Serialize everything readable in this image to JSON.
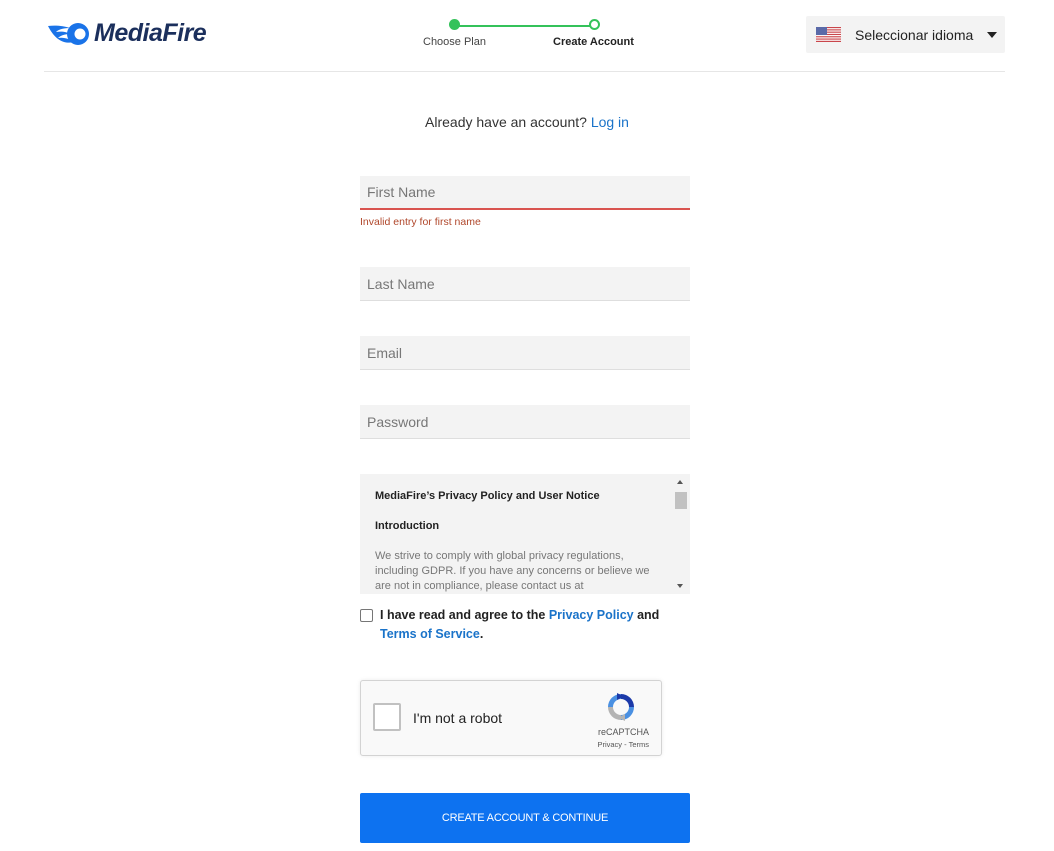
{
  "header": {
    "logo_text": "MediaFire",
    "steps": [
      {
        "label": "Choose Plan",
        "status": "complete"
      },
      {
        "label": "Create Account",
        "status": "current"
      }
    ],
    "language_selector": {
      "label": "Seleccionar idioma",
      "flag_icon": "us-flag-icon"
    }
  },
  "login_prompt": {
    "text": "Already have an account?",
    "link_label": "Log in"
  },
  "form": {
    "first_name": {
      "placeholder": "First Name",
      "value": "",
      "error": "Invalid entry for first name"
    },
    "last_name": {
      "placeholder": "Last Name",
      "value": ""
    },
    "email": {
      "placeholder": "Email",
      "value": ""
    },
    "password": {
      "placeholder": "Password",
      "value": ""
    }
  },
  "policy": {
    "title": "MediaFire’s Privacy Policy and User Notice",
    "section": "Introduction",
    "body": "We strive to comply with global privacy regulations, including GDPR. If you have any concerns or believe we are not in compliance, please contact us at"
  },
  "agreement": {
    "checked": false,
    "text_before": "I have read and agree to the",
    "privacy_link": "Privacy Policy",
    "text_and": "and",
    "terms_link": "Terms of Service",
    "text_end": "."
  },
  "captcha": {
    "label": "I'm not a robot",
    "brand": "reCAPTCHA",
    "links": "Privacy - Terms",
    "checked": false
  },
  "submit": {
    "label": "CREATE ACCOUNT & CONTINUE"
  },
  "colors": {
    "accent_blue": "#0d72f0",
    "link_blue": "#1a73c9",
    "step_green": "#34c25a",
    "error_red": "#d9534f",
    "logo_navy": "#1b2f5c"
  }
}
